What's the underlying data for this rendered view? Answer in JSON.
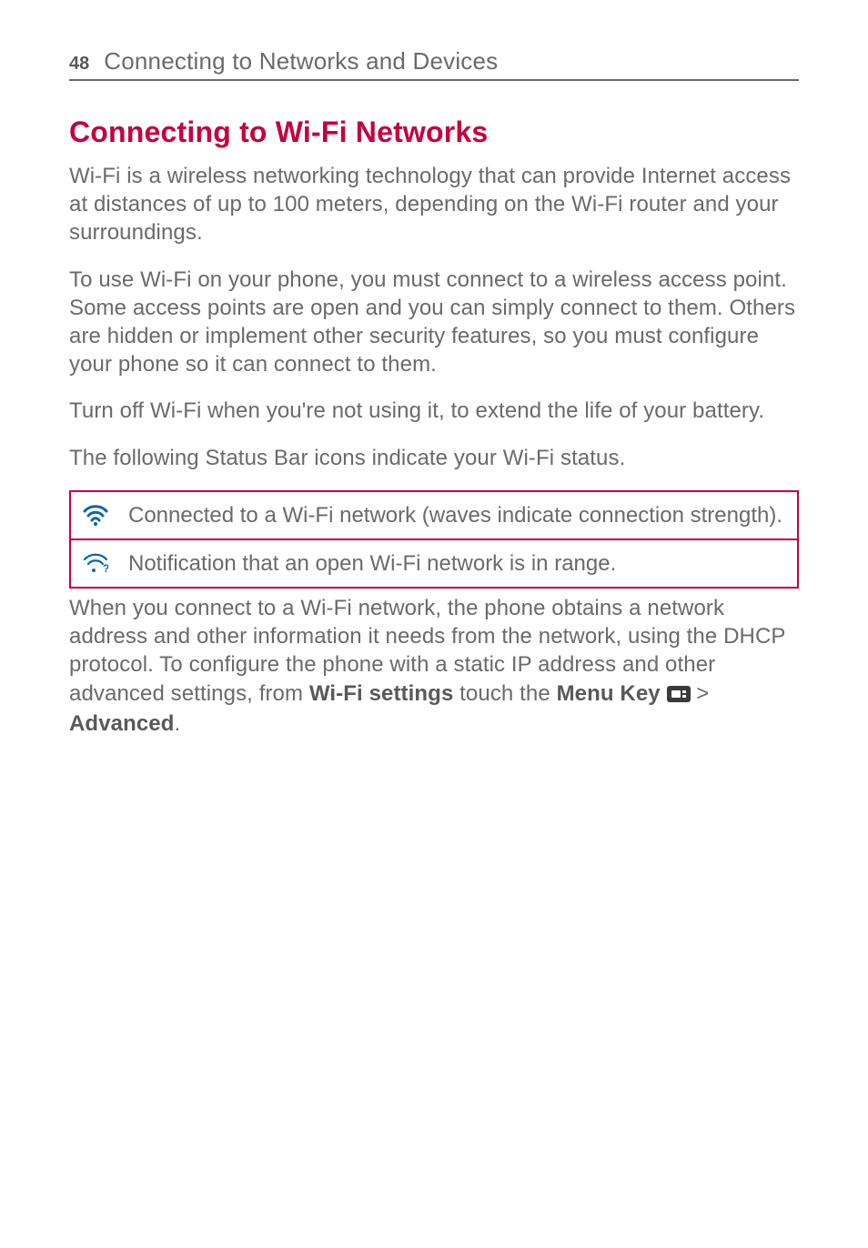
{
  "header": {
    "page_number": "48",
    "title": "Connecting to Networks and Devices"
  },
  "heading": "Connecting to Wi-Fi Networks",
  "paragraphs": {
    "p1": "Wi-Fi is a wireless networking technology that can provide Internet access at distances of up to 100 meters, depending on the Wi-Fi router and your surroundings.",
    "p2": "To use Wi-Fi on your phone, you must connect to a wireless access point. Some access points are open and you can simply connect to them. Others are hidden or implement other security features, so you must configure your phone so it can connect to them.",
    "p3": "Turn off Wi-Fi when you're not using it, to extend the life of your battery.",
    "p4": "The following Status Bar icons indicate your Wi-Fi status."
  },
  "table": {
    "row1": "Connected to a Wi-Fi network (waves indicate connection strength).",
    "row2": "Notification that an open Wi-Fi network is in range."
  },
  "trailing": {
    "part1": "When you connect to a Wi-Fi network, the phone obtains a network address and other information it needs from the network, using the DHCP protocol. To configure the phone with a static IP address and other advanced settings, from ",
    "bold1": "Wi-Fi settings",
    "part2": " touch the ",
    "bold2": "Menu Key",
    "part3": " > ",
    "bold3": "Advanced",
    "part4": "."
  }
}
